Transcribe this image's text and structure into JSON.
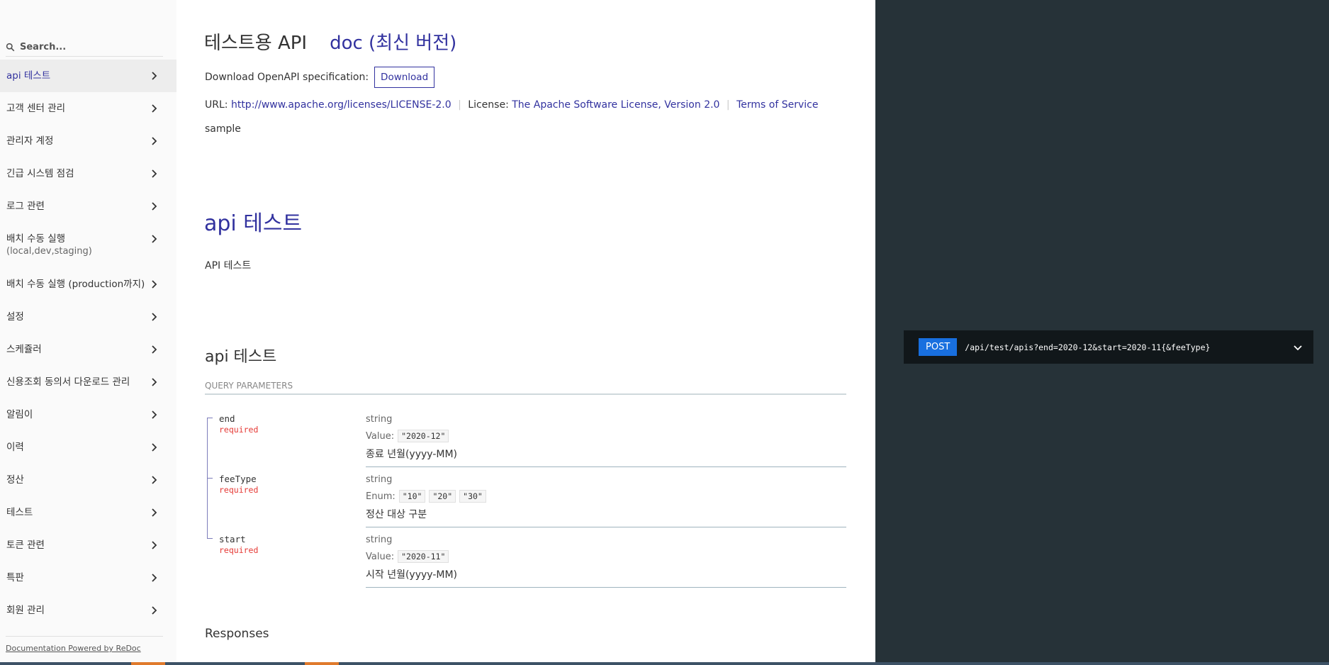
{
  "search": {
    "placeholder": "Search..."
  },
  "sidebar": {
    "items": [
      {
        "label": "api 테스트"
      },
      {
        "label": "고객 센터 관리"
      },
      {
        "label": "관리자 계정"
      },
      {
        "label": "긴급 시스템 점검"
      },
      {
        "label": "로그 관련"
      },
      {
        "label": "배치 수동 실행",
        "sub": "(local,dev,staging)"
      },
      {
        "label": "배치 수동 실행 (production까지)"
      },
      {
        "label": "설정"
      },
      {
        "label": "스케쥴러"
      },
      {
        "label": "신용조회 동의서 다운로드 관리"
      },
      {
        "label": "알림이"
      },
      {
        "label": "이력"
      },
      {
        "label": "정산"
      },
      {
        "label": "테스트"
      },
      {
        "label": "토큰 관련"
      },
      {
        "label": "특판"
      },
      {
        "label": "회원 관리"
      }
    ],
    "footer": "Documentation Powered by ReDoc"
  },
  "header": {
    "title": "테스트용 API",
    "version": "doc (최신 버전)"
  },
  "download": {
    "label": "Download OpenAPI specification:",
    "button": "Download"
  },
  "info": {
    "url_label": "URL:",
    "url": "http://www.apache.org/licenses/LICENSE-2.0",
    "license_label": "License:",
    "license": "The Apache Software License, Version 2.0",
    "terms": "Terms of Service",
    "description": "sample"
  },
  "tag": {
    "title": "api 테스트",
    "description": "API 테스트"
  },
  "operation": {
    "title": "api 테스트",
    "params_header": "QUERY PARAMETERS",
    "params": [
      {
        "name": "end",
        "required": "required",
        "type": "string",
        "value_label": "Value:",
        "values": [
          "\"2020-12\""
        ],
        "description": "종료 년월(yyyy-MM)"
      },
      {
        "name": "feeType",
        "required": "required",
        "type": "string",
        "value_label": "Enum:",
        "values": [
          "\"10\"",
          "\"20\"",
          "\"30\""
        ],
        "description": "정산 대상 구분"
      },
      {
        "name": "start",
        "required": "required",
        "type": "string",
        "value_label": "Value:",
        "values": [
          "\"2020-11\""
        ],
        "description": "시작 년월(yyyy-MM)"
      }
    ],
    "responses_title": "Responses"
  },
  "endpoint": {
    "method": "POST",
    "path": "/api/test/apis?end=2020-12&start=2020-11{&feeType}"
  },
  "colors": {
    "accent": "#32329f",
    "right_panel": "#263238",
    "method_badge": "#186fdf",
    "required": "#e53935"
  }
}
